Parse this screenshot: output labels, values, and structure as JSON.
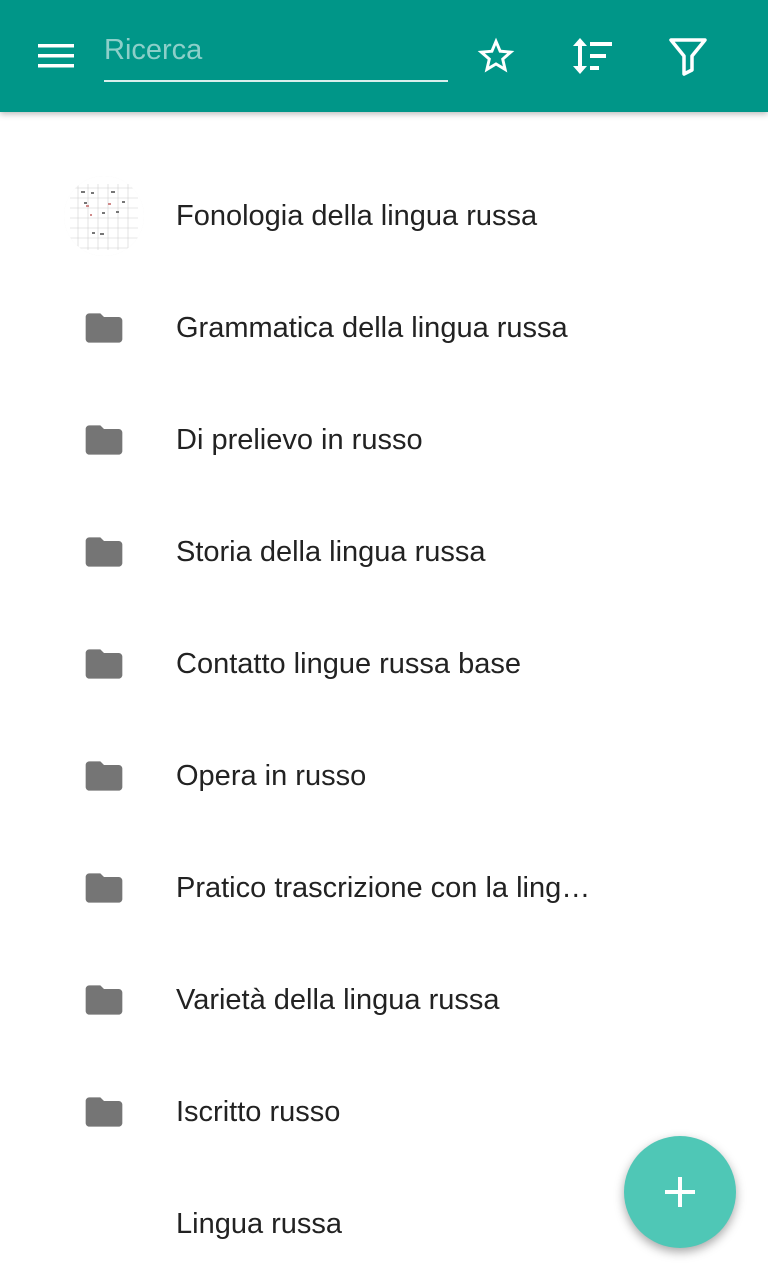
{
  "appbar": {
    "background": "#009688",
    "menu_icon": "menu-icon",
    "search": {
      "placeholder": "Ricerca",
      "value": ""
    },
    "actions": [
      {
        "name": "favorites-button",
        "icon": "star-outline-icon"
      },
      {
        "name": "sort-button",
        "icon": "sort-icon"
      },
      {
        "name": "filter-button",
        "icon": "filter-icon"
      }
    ]
  },
  "list": {
    "items": [
      {
        "label": "Fonologia della lingua russa",
        "icon": "thumbnail-image"
      },
      {
        "label": "Grammatica della lingua russa",
        "icon": "folder-icon"
      },
      {
        "label": "Di prelievo in russo",
        "icon": "folder-icon"
      },
      {
        "label": "Storia della lingua russa",
        "icon": "folder-icon"
      },
      {
        "label": "Contatto lingue russa base",
        "icon": "folder-icon"
      },
      {
        "label": "Opera in russo",
        "icon": "folder-icon"
      },
      {
        "label": "Pratico trascrizione con la lingua russa",
        "icon": "folder-icon"
      },
      {
        "label": "Varietà della lingua russa",
        "icon": "folder-icon"
      },
      {
        "label": "Iscritto russo",
        "icon": "folder-icon"
      },
      {
        "label": "Lingua russa",
        "icon": "none"
      }
    ]
  },
  "fab": {
    "icon": "plus-icon",
    "color": "#4fc7b6"
  }
}
